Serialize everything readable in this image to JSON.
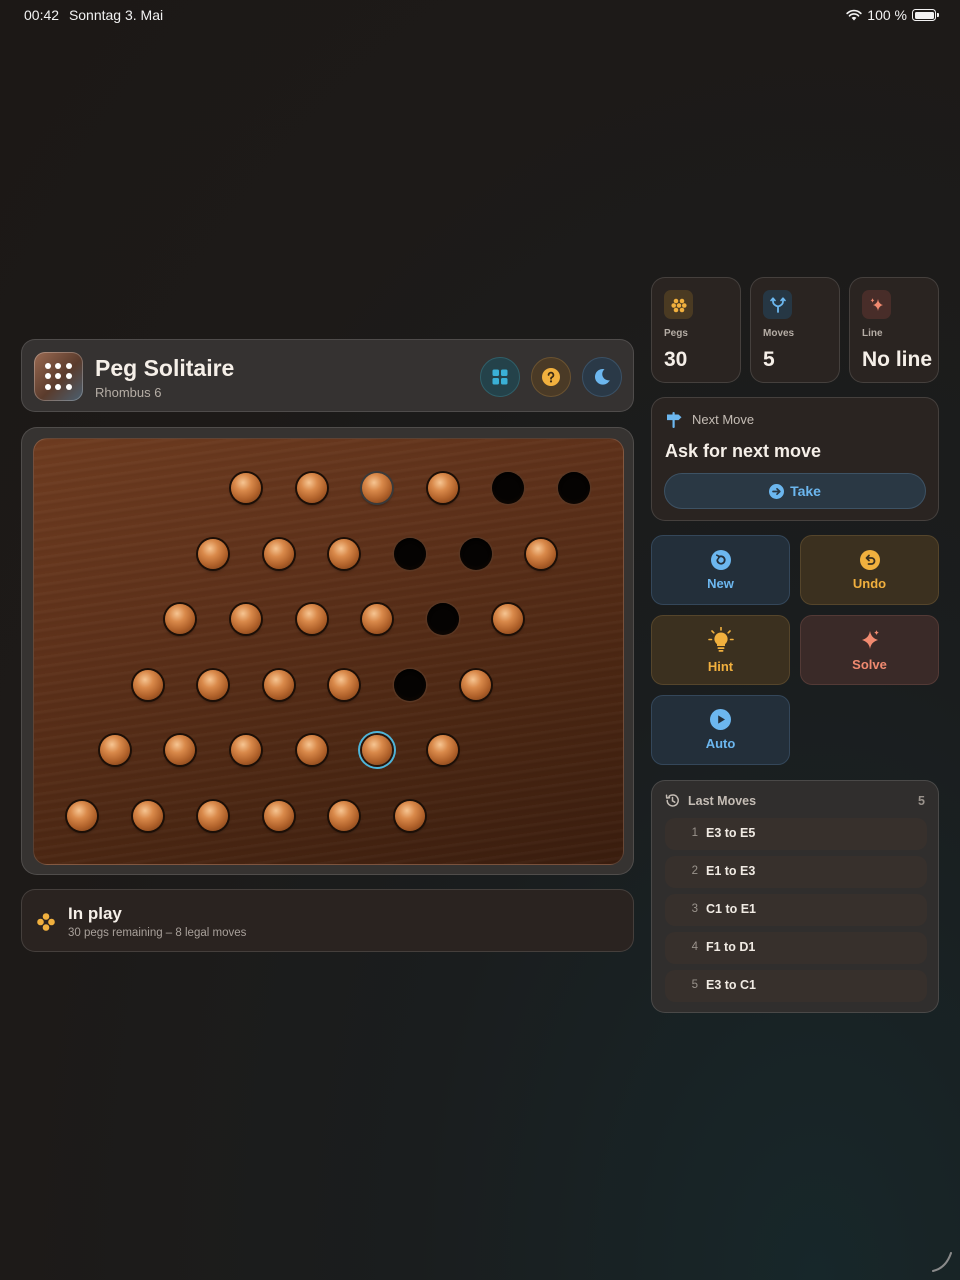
{
  "status_bar": {
    "time": "00:42",
    "date": "Sonntag 3. Mai",
    "battery": "100 %"
  },
  "header": {
    "title": "Peg Solitaire",
    "subtitle": "Rhombus 6",
    "icons": {
      "layout": "grid-icon",
      "help": "help-icon",
      "theme": "moon-icon"
    }
  },
  "board": {
    "rows": [
      "ooo.xx",
      "ooo.xxo",
      "oooox.o",
      "ooooox.o",
      "oooo.ooo",
      "oooooo"
    ],
    "layout_rows": [
      [
        "peg",
        "peg",
        "peg",
        "peg",
        "hole",
        "hole"
      ],
      [
        "peg",
        "peg",
        "peg",
        "hole",
        "hole",
        "peg"
      ],
      [
        "peg",
        "peg",
        "peg",
        "peg",
        "hole",
        "peg"
      ],
      [
        "peg",
        "peg",
        "peg",
        "peg",
        "hole",
        "peg"
      ],
      [
        "peg",
        "peg",
        "peg",
        "peg",
        "peg",
        "peg"
      ],
      [
        "peg",
        "peg",
        "peg",
        "peg",
        "peg",
        "peg"
      ]
    ],
    "selected": {
      "row": 5,
      "col": 5
    },
    "dimmed": [
      {
        "row": 1,
        "col": 3
      }
    ]
  },
  "status": {
    "title": "In play",
    "detail": "30 pegs remaining – 8 legal moves",
    "icon": "pegs-cluster-icon"
  },
  "stats": [
    {
      "label": "Pegs",
      "value": "30",
      "icon": "pegs-icon",
      "accent": "#f1b03e"
    },
    {
      "label": "Moves",
      "value": "5",
      "icon": "branch-icon",
      "accent": "#6cb7ef"
    },
    {
      "label": "Line",
      "value": "No line",
      "icon": "sparkle-icon",
      "accent": "#f08a70"
    }
  ],
  "next_move": {
    "label": "Next Move",
    "text": "Ask for next move",
    "button": "Take"
  },
  "actions": {
    "new": "New",
    "undo": "Undo",
    "hint": "Hint",
    "solve": "Solve",
    "auto": "Auto"
  },
  "last_moves": {
    "title": "Last Moves",
    "count": "5",
    "items": [
      {
        "n": "1",
        "move": "E3 to E5"
      },
      {
        "n": "2",
        "move": "E1 to E3"
      },
      {
        "n": "3",
        "move": "C1 to E1"
      },
      {
        "n": "4",
        "move": "F1 to D1"
      },
      {
        "n": "5",
        "move": "E3 to C1"
      }
    ]
  }
}
